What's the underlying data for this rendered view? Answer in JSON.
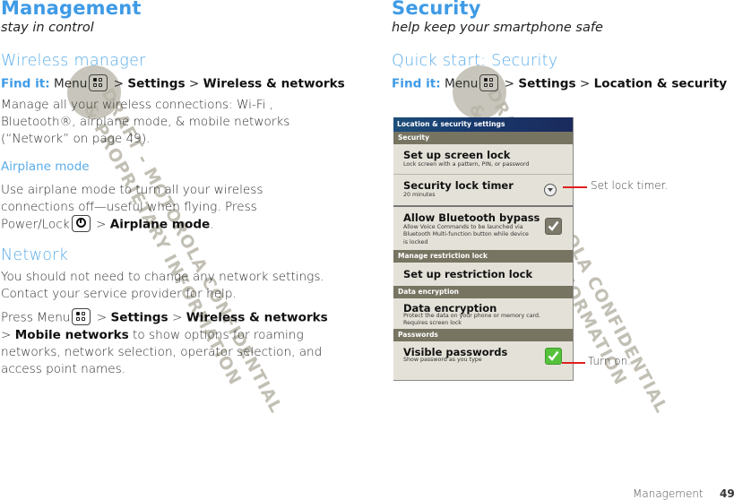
{
  "left_page": {
    "title": "Management",
    "subtitle": "stay in control",
    "wireless_manager": {
      "heading": "Wireless manager",
      "find_it_label": "Find it:",
      "find_it_menu": "Menu",
      "path_settings": "Settings",
      "path_wireless": "Wireless & networks",
      "separator": ">",
      "body_lines": [
        "Manage all your wireless connections: Wi-Fi   ,",
        "Bluetooth®, airplane mode, & mobile networks",
        "(“Network” on page 49)."
      ]
    },
    "airplane_mode": {
      "heading": "Airplane mode",
      "body_line1": "Use airplane mode to turn all your wireless",
      "body_line2": "connections off—useful when flying. Press",
      "body_line3_prefix": "Power/Lock",
      "body_line3_bold": "Airplane mode",
      "body_line3_suffix": "."
    },
    "network": {
      "heading": "Network",
      "para1_line1": "You should not need to change any network settings.",
      "para1_line2": "Contact your service provider for help.",
      "para2_prefix": "Press Menu",
      "para2_settings": "Settings",
      "para2_wireless": "Wireless & networks",
      "para2_mobile": "Mobile networks",
      "para2_rest1": "to show options for roaming",
      "para2_line3": "networks, network selection, operator selection, and",
      "para2_line4": "access point names."
    }
  },
  "right_page": {
    "title": "Security",
    "subtitle": "help keep your smartphone safe",
    "quick_start": {
      "heading": "Quick start: Security",
      "find_it_label": "Find it:",
      "find_it_menu": "Menu",
      "path_settings": "Settings",
      "path_location": "Location & security"
    },
    "phone_screen": {
      "title": "Location & security settings",
      "sections": {
        "security": "Security",
        "manage_restriction": "Manage restriction lock",
        "data_encryption": "Data encryption",
        "passwords": "Passwords"
      },
      "items": {
        "screen_lock": {
          "title": "Set up screen lock",
          "desc": "Lock screen with a pattern, PIN, or password"
        },
        "lock_timer": {
          "title": "Security lock timer",
          "desc": "20 minutes"
        },
        "bt_bypass": {
          "title": "Allow Bluetooth bypass",
          "desc_lines": [
            "Allow Voice Commands to be launched via",
            "Bluetooth Multi-function button while device",
            "is locked"
          ],
          "checked": true
        },
        "restriction_lock": {
          "title": "Set up restriction lock"
        },
        "encryption": {
          "title": "Data encryption",
          "desc_lines": [
            "Protect the data on your phone or memory card.",
            "Requires screen lock"
          ]
        },
        "visible_passwords": {
          "title": "Visible passwords",
          "desc": "Show password as you type",
          "checked": true
        }
      },
      "colors": {
        "title_bar": "#1b2a5c",
        "section_header": "#777462",
        "background": "#e4e2d8",
        "checkbox_on": "#56c23c"
      }
    },
    "callouts": {
      "lock_timer": "Set lock timer.",
      "visible_passwords": "Turn on."
    }
  },
  "watermark": {
    "line1": "DRAFT - MOTOROLA CONFIDENTIAL",
    "line2": "& PROPRIETARY INFORMATION"
  },
  "footer": {
    "section": "Management",
    "page_number": "49"
  },
  "colors": {
    "heading_blue": "#3f9be6",
    "callout_red": "#e02020"
  }
}
